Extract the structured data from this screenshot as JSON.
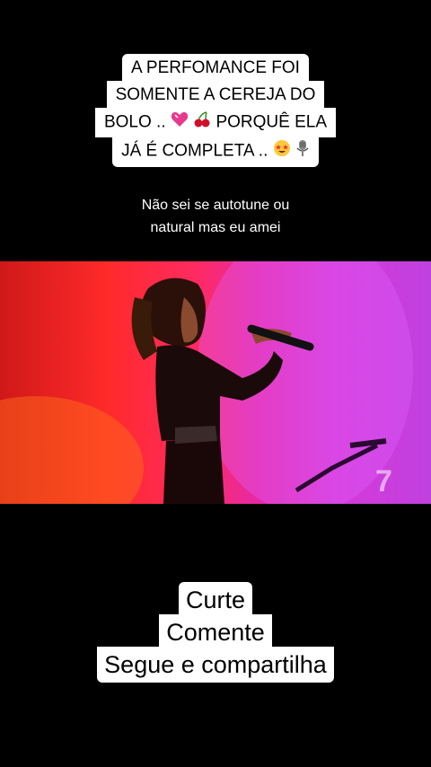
{
  "caption": {
    "lines": [
      "A PERFOMANCE FOI",
      "SOMENTE A CEREJA DO",
      "BOLO ..",
      "PORQUÊ ELA",
      "JÁ É COMPLETA .."
    ],
    "icons": [
      "heart-icon",
      "cherry-icon",
      "star-struck-icon",
      "microphone-icon"
    ]
  },
  "subtitle": {
    "line1": "Não sei se autotune ou",
    "line2": "natural mas eu amei"
  },
  "video": {
    "description_icon": "singer-video",
    "channel_logo": "7"
  },
  "bottom": {
    "line1": "Curte",
    "line2": "Comente",
    "line3": "Segue e compartilha"
  },
  "colors": {
    "background": "#000000",
    "caption_bg": "#ffffff",
    "video_red": "#ff2a2a",
    "video_magenta": "#c040e0"
  }
}
